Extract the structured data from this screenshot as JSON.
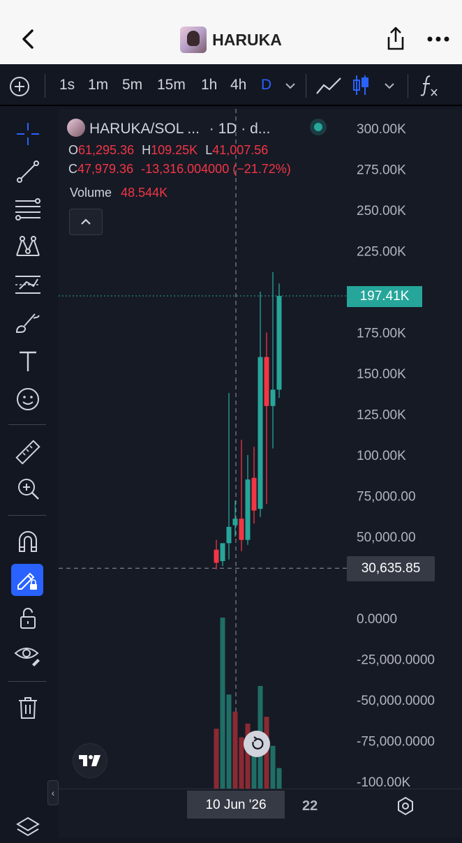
{
  "header": {
    "title": "HARUKA"
  },
  "toolbar": {
    "timeframes": [
      "1s",
      "1m",
      "5m",
      "15m",
      "1h",
      "4h",
      "D"
    ],
    "active_timeframe": "D"
  },
  "legend": {
    "symbol": "HARUKA/SOL ...",
    "interval": "· 1D · d...",
    "open_label": "O",
    "open": "61,295.36",
    "high_label": "H",
    "high": "109.25K",
    "low_label": "L",
    "low": "41,007.56",
    "close_label": "C",
    "close": "47,979.36",
    "change": "-13,316.004000 (−21.72%)",
    "volume_label": "Volume",
    "volume": "48.544K"
  },
  "price_axis": {
    "labels": [
      "300.00K",
      "275.00K",
      "250.00K",
      "225.00K",
      "175.00K",
      "150.00K",
      "125.00K",
      "100.00K",
      "75,000.00",
      "50,000.00",
      "0.0000",
      "-25,000.0000",
      "-50,000.0000",
      "-75,000.0000",
      "-100.00K"
    ],
    "last_price": "197.41K",
    "crosshair_price": "30,635.85"
  },
  "time_axis": {
    "crosshair_date": "10 Jun '26",
    "labels": [
      "22"
    ]
  },
  "colors": {
    "up": "#26a69a",
    "down": "#f23645",
    "accent": "#2962ff",
    "bg": "#161a25"
  },
  "chart_data": {
    "type": "candlestick",
    "y_range": [
      -100000,
      300000
    ],
    "candles": [
      {
        "o": 42000,
        "h": 48000,
        "l": 30000,
        "c": 34000
      },
      {
        "o": 35000,
        "h": 45000,
        "l": 32000,
        "c": 46000
      },
      {
        "o": 46000,
        "h": 138000,
        "l": 36000,
        "c": 56000
      },
      {
        "o": 57000,
        "h": 72000,
        "l": 50000,
        "c": 61000
      },
      {
        "o": 61000,
        "h": 109250,
        "l": 41008,
        "c": 47979
      },
      {
        "o": 48000,
        "h": 100000,
        "l": 45000,
        "c": 85000
      },
      {
        "o": 86000,
        "h": 105000,
        "l": 58000,
        "c": 66000
      },
      {
        "o": 67000,
        "h": 200000,
        "l": 62000,
        "c": 160000
      },
      {
        "o": 160000,
        "h": 175000,
        "l": 70000,
        "c": 130000
      },
      {
        "o": 130000,
        "h": 212000,
        "l": 104000,
        "c": 140000
      },
      {
        "o": 140000,
        "h": 205000,
        "l": 135000,
        "c": 197410
      }
    ],
    "volume": [
      {
        "v": 0.35,
        "up": false
      },
      {
        "v": 1.0,
        "up": true
      },
      {
        "v": 0.55,
        "up": true
      },
      {
        "v": 0.45,
        "up": false
      },
      {
        "v": 0.3,
        "up": false
      },
      {
        "v": 0.38,
        "up": false
      },
      {
        "v": 0.22,
        "up": true
      },
      {
        "v": 0.6,
        "up": true
      },
      {
        "v": 0.42,
        "up": false
      },
      {
        "v": 0.25,
        "up": true
      },
      {
        "v": 0.12,
        "up": true
      }
    ]
  }
}
